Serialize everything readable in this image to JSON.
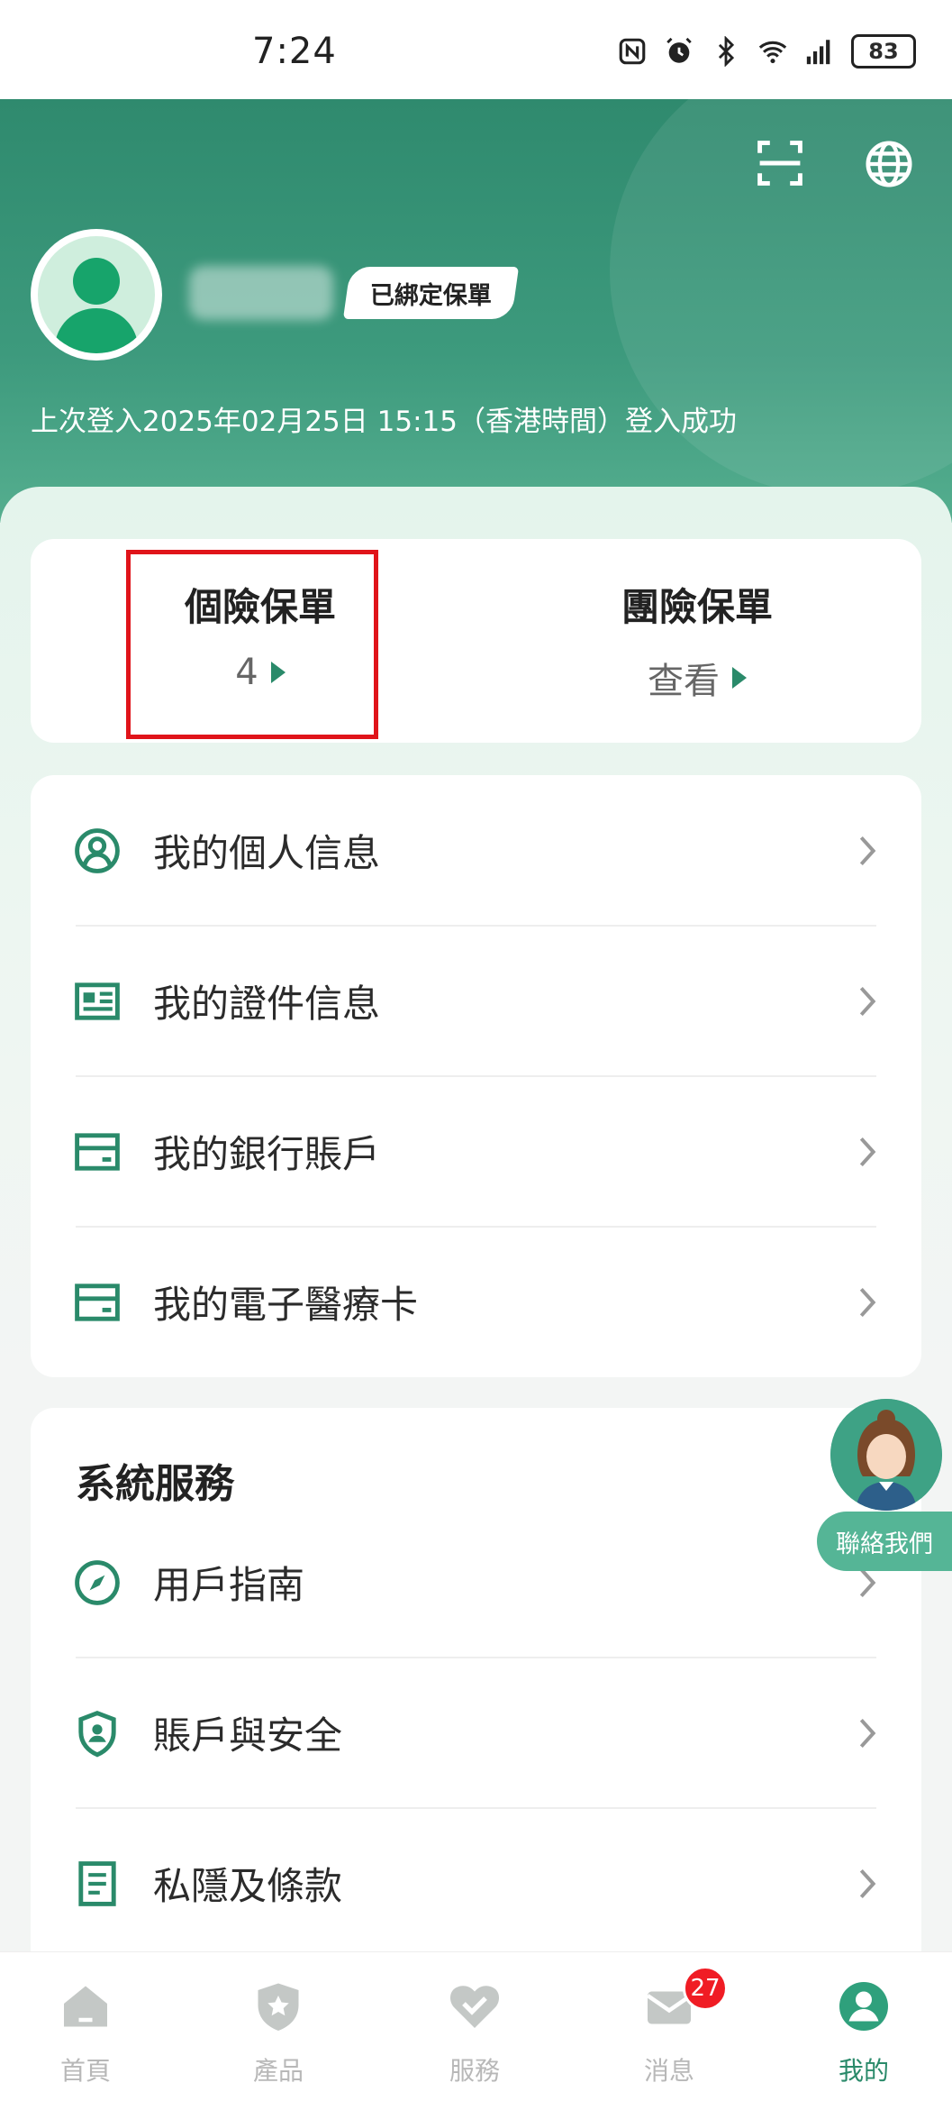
{
  "status_bar": {
    "time": "7:24",
    "battery": "83"
  },
  "header": {
    "user_name_blurred": "",
    "bound_badge": "已綁定保單",
    "login_info": "上次登入2025年02月25日 15:15（香港時間）登入成功"
  },
  "policies": {
    "personal": {
      "title": "個險保單",
      "value": "4"
    },
    "group": {
      "title": "團險保單",
      "value": "查看"
    }
  },
  "menu": [
    {
      "label": "我的個人信息",
      "icon": "user-circle-icon"
    },
    {
      "label": "我的證件信息",
      "icon": "id-card-icon"
    },
    {
      "label": "我的銀行賬戶",
      "icon": "bank-card-icon"
    },
    {
      "label": "我的電子醫療卡",
      "icon": "medical-card-icon"
    }
  ],
  "system": {
    "title": "系統服務",
    "items": [
      {
        "label": "用戶指南",
        "icon": "compass-icon"
      },
      {
        "label": "賬戶與安全",
        "icon": "shield-user-icon"
      },
      {
        "label": "私隱及條款",
        "icon": "document-icon"
      }
    ]
  },
  "contact": {
    "label": "聯絡我們"
  },
  "bottom_nav": [
    {
      "label": "首頁",
      "icon": "home-icon"
    },
    {
      "label": "產品",
      "icon": "shield-star-icon"
    },
    {
      "label": "服務",
      "icon": "service-icon"
    },
    {
      "label": "消息",
      "icon": "message-icon",
      "badge": "27"
    },
    {
      "label": "我的",
      "icon": "profile-icon",
      "active": true
    }
  ],
  "colors": {
    "brand": "#2f8a6e",
    "accent": "#2a8a6a",
    "highlight": "#e0141a",
    "badge": "#f01c24"
  }
}
